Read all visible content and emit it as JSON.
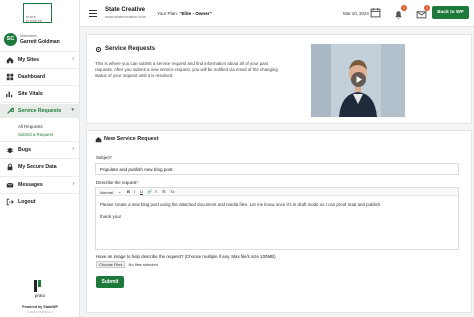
{
  "brand": {
    "logo_line1": "state",
    "logo_line2": "creative",
    "name": "prato",
    "powered": "Powered by StateWP",
    "copyright": "© 2024 STATE LLC"
  },
  "user": {
    "initials": "SC",
    "welcome": "Welcome,",
    "name": "Garrett Goldman"
  },
  "sidebar": {
    "items": [
      {
        "label": "My Sites",
        "icon": "home-icon"
      },
      {
        "label": "Dashboard",
        "icon": "dashboard-icon"
      },
      {
        "label": "Site Vitals",
        "icon": "pulse-icon"
      },
      {
        "label": "Service Requests",
        "icon": "wrench-icon"
      },
      {
        "label": "Bugs",
        "icon": "bug-icon"
      },
      {
        "label": "My Secure Data",
        "icon": "lock-icon"
      },
      {
        "label": "Messages",
        "icon": "mail-icon"
      },
      {
        "label": "Logout",
        "icon": "logout-icon"
      }
    ],
    "sub_items": [
      {
        "label": "All Requests"
      },
      {
        "label": "Submit a Request"
      }
    ]
  },
  "topbar": {
    "site_name": "State Creative",
    "site_url": "www.statecreative.com",
    "plan_prefix": "Your Plan:",
    "plan_value": "\"Elite - Owner\"",
    "date": "Mar 10, 2024",
    "notification_count": "1",
    "message_count": "3",
    "back_button": "Back to WP"
  },
  "service_requests": {
    "title": "Service Requests",
    "intro": "This is where you can submit a service request and find information about all of your past requests. After you submit a new service request, you will be notified via email of the changing status of your request until it is resolved."
  },
  "new_request": {
    "title": "New Service Request",
    "subject_label": "Subject",
    "subject_value": "Populate and publish new blog post",
    "describe_label": "Describe the request",
    "toolbar_format": "Normal",
    "editor_line1": "Please create a new blog post using the attached document and media files. Let me know once it's in draft mode so I can proof read and publish.",
    "editor_line2": "thank you!",
    "image_label": "Have an image to help describe the request? (Choose multiple if any. Max file/s size 100MB)",
    "choose_files": "Choose Files",
    "no_files": "No files selected",
    "submit": "Submit"
  },
  "colors": {
    "accent": "#1e7a3c",
    "badge": "#e05a2b"
  }
}
